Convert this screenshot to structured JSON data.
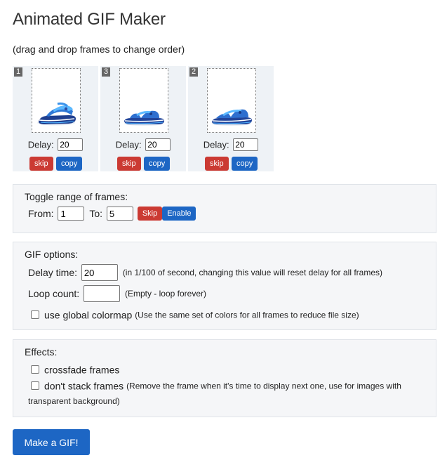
{
  "page": {
    "title": "Animated GIF Maker",
    "subtitle": "(drag and drop frames to change order)"
  },
  "frames": [
    {
      "number": "1",
      "delay_label": "Delay:",
      "delay": "20",
      "skip_label": "skip",
      "copy_label": "copy"
    },
    {
      "number": "3",
      "delay_label": "Delay:",
      "delay": "20",
      "skip_label": "skip",
      "copy_label": "copy"
    },
    {
      "number": "2",
      "delay_label": "Delay:",
      "delay": "20",
      "skip_label": "skip",
      "copy_label": "copy"
    }
  ],
  "toggle": {
    "title": "Toggle range of frames:",
    "from_label": "From:",
    "from_value": "1",
    "to_label": "To:",
    "to_value": "5",
    "skip_label": "Skip",
    "enable_label": "Enable"
  },
  "gif_options": {
    "title": "GIF options:",
    "delay_label": "Delay time:",
    "delay_value": "20",
    "delay_hint": "(in 1/100 of second, changing this value will reset delay for all frames)",
    "loop_label": "Loop count:",
    "loop_value": "",
    "loop_hint": "(Empty - loop forever)",
    "colormap_label": "use global colormap",
    "colormap_hint": "(Use the same set of colors for all frames to reduce file size)"
  },
  "effects": {
    "title": "Effects:",
    "crossfade_label": "crossfade frames",
    "nostack_label": "don't stack frames",
    "nostack_hint_1": "(Remove the frame when it's time to display next one, use for images with",
    "nostack_hint_2": "transparent background)"
  },
  "make_button": "Make a GIF!",
  "colors": {
    "skip_red": "#cb3a33",
    "copy_blue": "#1d66c4",
    "panel_bg": "#f5f6f8",
    "frame_bg": "#eef2f6"
  }
}
